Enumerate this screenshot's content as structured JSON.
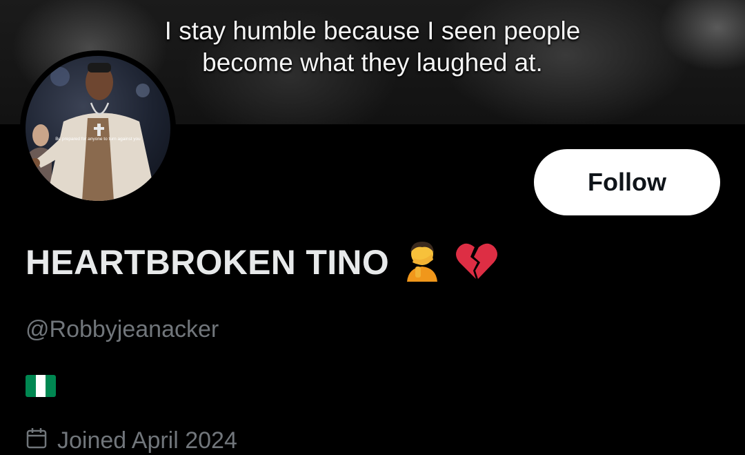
{
  "banner": {
    "caption_line1": "I stay humble because I seen people",
    "caption_line2": "become what they laughed at."
  },
  "avatar": {
    "overlay_text": "Be prepared for anyone to turn against you"
  },
  "profile": {
    "display_name": "HEARTBROKEN TINO",
    "handle": "@Robbyjeanacker",
    "joined": "Joined April 2024"
  },
  "actions": {
    "follow_label": "Follow"
  },
  "icons": {
    "name_emoji_1": "person-facepalming-icon",
    "name_emoji_2": "broken-heart-icon",
    "bio_flag": "nigeria-flag-icon",
    "joined": "calendar-icon"
  },
  "colors": {
    "background": "#000000",
    "primary_text": "#e7e9ea",
    "secondary_text": "#71767b",
    "follow_bg": "#ffffff",
    "flag_green": "#008751"
  }
}
